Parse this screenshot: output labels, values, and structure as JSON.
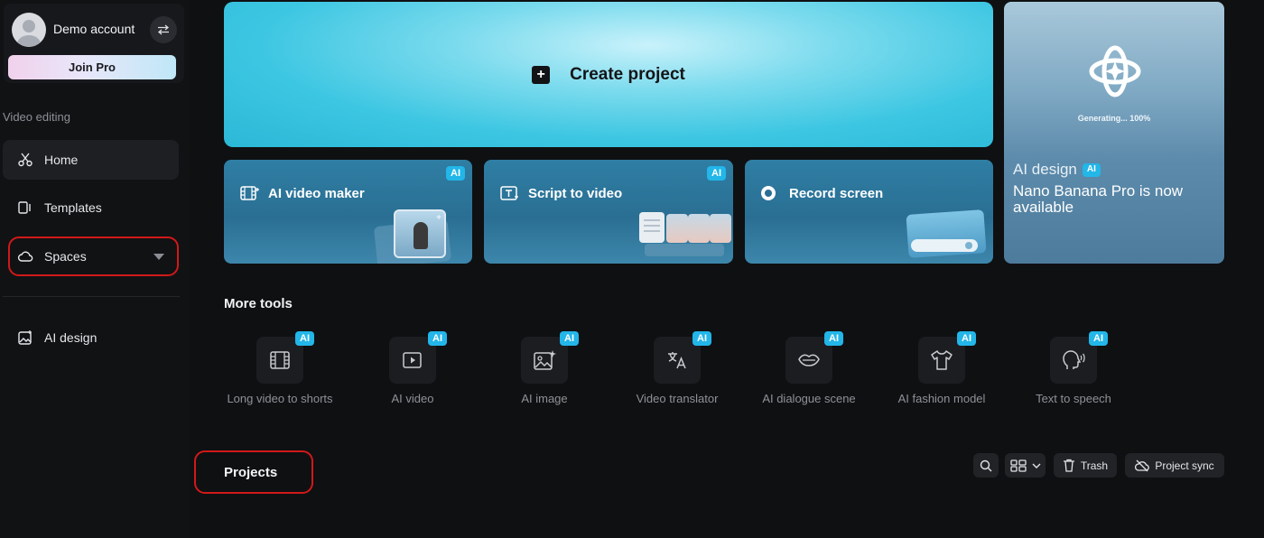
{
  "sidebar": {
    "account_name": "Demo account",
    "join_pro": "Join Pro",
    "section_label": "Video editing",
    "items": [
      {
        "label": "Home"
      },
      {
        "label": "Templates"
      },
      {
        "label": "Spaces"
      },
      {
        "label": "AI design"
      }
    ]
  },
  "hero": {
    "create_label": "Create project",
    "cards": [
      {
        "label": "AI video maker",
        "badge": "AI"
      },
      {
        "label": "Script to video",
        "badge": "AI"
      },
      {
        "label": "Record screen"
      }
    ]
  },
  "promo": {
    "generating": "Generating... 100%",
    "title": "AI design",
    "badge": "AI",
    "text": "Nano Banana Pro is now available"
  },
  "more_tools": {
    "title": "More tools",
    "badge": "AI",
    "items": [
      {
        "label": "Long video to shorts"
      },
      {
        "label": "AI video"
      },
      {
        "label": "AI image"
      },
      {
        "label": "Video translator"
      },
      {
        "label": "AI dialogue scene"
      },
      {
        "label": "AI fashion model"
      },
      {
        "label": "Text to speech"
      }
    ]
  },
  "projects": {
    "title": "Projects",
    "trash": "Trash",
    "sync": "Project sync"
  },
  "colors": {
    "accent": "#22b6e9",
    "highlight_outline": "#d11919"
  }
}
